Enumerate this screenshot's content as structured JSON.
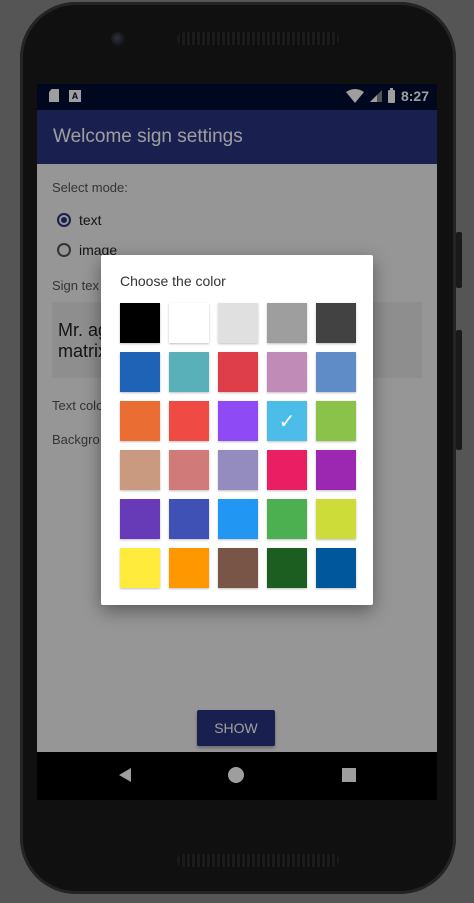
{
  "status_bar": {
    "time": "8:27",
    "icons": [
      "sd-card-icon",
      "text-a-icon",
      "wifi-icon",
      "signal-icon",
      "battery-icon"
    ]
  },
  "app_bar": {
    "title": "Welcome sign settings"
  },
  "form": {
    "select_mode_label": "Select mode:",
    "mode_options": [
      {
        "label": "text",
        "checked": true
      },
      {
        "label": "image",
        "checked": false
      }
    ],
    "sign_text_label": "Sign tex",
    "sign_text_value": "Mr. ag\nmatrix",
    "text_color_label": "Text colo",
    "background_label": "Backgro",
    "show_button": "SHOW"
  },
  "dialog": {
    "title": "Choose the color",
    "swatches": [
      {
        "color": "#000000",
        "selected": false
      },
      {
        "color": "#ffffff",
        "selected": false
      },
      {
        "color": "#e0e0e0",
        "selected": false
      },
      {
        "color": "#9e9e9e",
        "selected": false
      },
      {
        "color": "#424242",
        "selected": false
      },
      {
        "color": "#1e63b5",
        "selected": false
      },
      {
        "color": "#5ab0b8",
        "selected": false
      },
      {
        "color": "#de3d4a",
        "selected": false
      },
      {
        "color": "#c08cb7",
        "selected": false
      },
      {
        "color": "#5f8cc6",
        "selected": false
      },
      {
        "color": "#ea6e34",
        "selected": false
      },
      {
        "color": "#f04a45",
        "selected": false
      },
      {
        "color": "#8e4af5",
        "selected": false
      },
      {
        "color": "#4bbde8",
        "selected": true
      },
      {
        "color": "#8bc34a",
        "selected": false
      },
      {
        "color": "#c99a80",
        "selected": false
      },
      {
        "color": "#d17a7a",
        "selected": false
      },
      {
        "color": "#948cbf",
        "selected": false
      },
      {
        "color": "#e91e63",
        "selected": false
      },
      {
        "color": "#9c27b0",
        "selected": false
      },
      {
        "color": "#673ab7",
        "selected": false
      },
      {
        "color": "#3f51b5",
        "selected": false
      },
      {
        "color": "#2196f3",
        "selected": false
      },
      {
        "color": "#4caf50",
        "selected": false
      },
      {
        "color": "#cddc39",
        "selected": false
      },
      {
        "color": "#ffeb3b",
        "selected": false
      },
      {
        "color": "#ff9800",
        "selected": false
      },
      {
        "color": "#795548",
        "selected": false
      },
      {
        "color": "#1b5e20",
        "selected": false
      },
      {
        "color": "#01579b",
        "selected": false
      }
    ]
  }
}
